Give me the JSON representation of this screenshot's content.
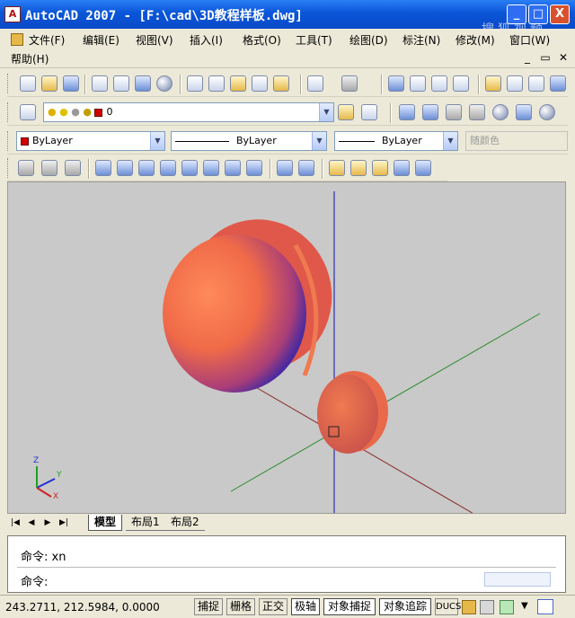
{
  "window": {
    "title": "AutoCAD 2007 - [F:\\cad\\3D教程样板.dwg]",
    "min": "_",
    "max": "□",
    "close": "X"
  },
  "watermark": "搜狐视频",
  "menu": [
    "文件(F)",
    "编辑(E)",
    "视图(V)",
    "插入(I)",
    "格式(O)",
    "工具(T)",
    "绘图(D)",
    "标注(N)",
    "修改(M)",
    "窗口(W)",
    "帮助(H)"
  ],
  "mdi_controls": [
    "_",
    "▭",
    "✕"
  ],
  "layer": {
    "name": "0"
  },
  "properties": {
    "color": "ByLayer",
    "linetype": "ByLayer",
    "lineweight": "ByLayer",
    "plotstyle": "随颜色"
  },
  "tabs": [
    "模型",
    "布局1",
    "布局2"
  ],
  "command": {
    "history": "命令: xn",
    "prompt": "命令:"
  },
  "status": {
    "coords": "243.2711, 212.5984, 0.0000",
    "buttons": [
      "捕捉",
      "栅格",
      "正交",
      "极轴",
      "对象捕捉",
      "对象追踪",
      "DUCS"
    ]
  },
  "ucs": {
    "x": "X",
    "y": "Y",
    "z": "Z"
  },
  "colors": {
    "titlebar": "#0a55d8",
    "viewport": "#c9c9c9",
    "solid_light": "#f07a50",
    "solid_dark": "#6a2b9a"
  }
}
